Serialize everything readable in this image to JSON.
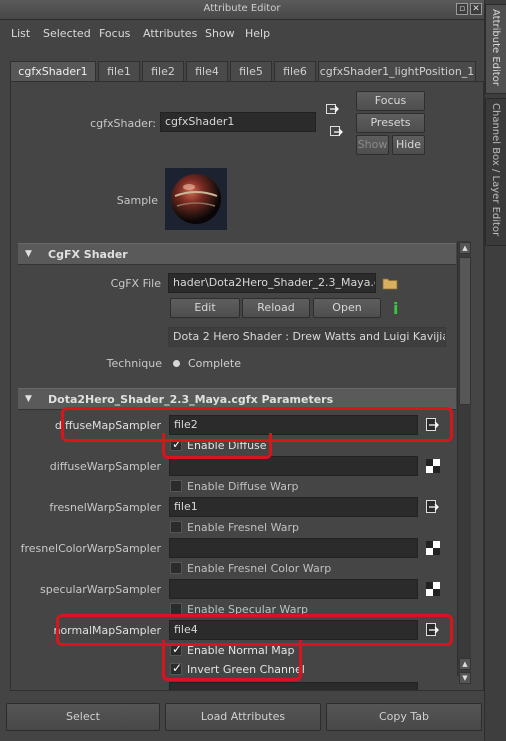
{
  "window": {
    "title": "Attribute Editor"
  },
  "menu": [
    "List",
    "Selected",
    "Focus",
    "Attributes",
    "Show",
    "Help"
  ],
  "side_tabs": [
    "Attribute Editor",
    "Channel Box / Layer Editor"
  ],
  "tabs": [
    {
      "label": "cgfxShader1",
      "active": true
    },
    {
      "label": "file1"
    },
    {
      "label": "file2"
    },
    {
      "label": "file4"
    },
    {
      "label": "file5"
    },
    {
      "label": "file6"
    },
    {
      "label": "cgfxShader1_lightPosition_1"
    }
  ],
  "node": {
    "type_label": "cgfxShader:",
    "name": "cgfxShader1",
    "buttons": {
      "focus": "Focus",
      "presets": "Presets",
      "show": "Show",
      "hide": "Hide"
    },
    "sample_label": "Sample"
  },
  "cgfx_section": {
    "title": "CgFX Shader",
    "file_label": "CgFX File",
    "file_value": "hader\\Dota2Hero_Shader_2.3_Maya.cgfx",
    "buttons": {
      "edit": "Edit",
      "reload": "Reload",
      "open": "Open"
    },
    "description": "Dota 2 Hero Shader : Drew Watts and Luigi Kavijian",
    "technique_label": "Technique",
    "technique_value": "Complete"
  },
  "params_section": {
    "title": "Dota2Hero_Shader_2.3_Maya.cgfx Parameters",
    "rows": [
      {
        "label": "diffuseMapSampler",
        "value": "file2",
        "checkbox": "Enable Diffuse",
        "checked": true,
        "highlight": true
      },
      {
        "label": "diffuseWarpSampler",
        "value": "",
        "checkbox": "Enable Diffuse Warp",
        "checked": false
      },
      {
        "label": "fresnelWarpSampler",
        "value": "file1",
        "checkbox": "Enable Fresnel Warp",
        "checked": false
      },
      {
        "label": "fresnelColorWarpSampler",
        "value": "",
        "checkbox": "Enable Fresnel Color Warp",
        "checked": false
      },
      {
        "label": "specularWarpSampler",
        "value": "",
        "checkbox": "Enable Specular Warp",
        "checked": false
      },
      {
        "label": "normalMapSampler",
        "value": "file4",
        "checkbox": "Enable Normal Map",
        "checked": true,
        "checkbox2": "Invert Green Channel",
        "checked2": true,
        "highlight": true
      }
    ]
  },
  "bottom_buttons": [
    "Select",
    "Load Attributes",
    "Copy Tab"
  ],
  "colors": {
    "highlight": "#d8141c",
    "info_icon": "#3cc83c",
    "folder_icon": "#d8b060"
  }
}
